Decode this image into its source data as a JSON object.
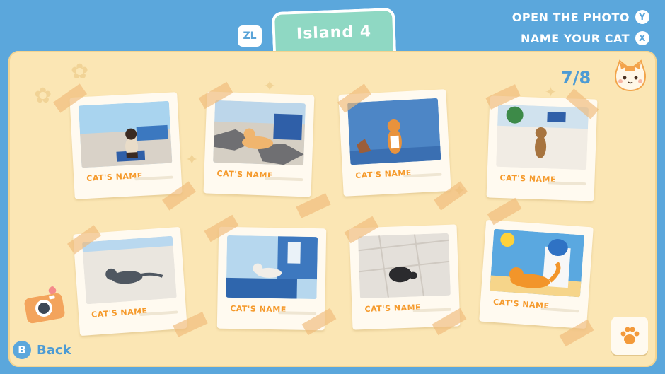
{
  "tabs": {
    "left_button": "ZL",
    "current": "Island 4"
  },
  "hints": [
    {
      "label": "OPEN THE PHOTO",
      "button": "Y"
    },
    {
      "label": "NAME YOUR CAT",
      "button": "X"
    }
  ],
  "counter": "7/8",
  "photos": [
    {
      "name": "CAT'S NAME",
      "icon": "siamese-cat-photo"
    },
    {
      "name": "CAT'S NAME",
      "icon": "orange-cat-lying-photo"
    },
    {
      "name": "CAT'S NAME",
      "icon": "orange-cat-sitting-photo"
    },
    {
      "name": "CAT'S NAME",
      "icon": "tabby-cat-photo"
    },
    {
      "name": "CAT'S NAME",
      "icon": "grey-cat-photo"
    },
    {
      "name": "CAT'S NAME",
      "icon": "white-cat-on-table-photo"
    },
    {
      "name": "CAT'S NAME",
      "icon": "black-cat-curled-photo"
    },
    {
      "name": "CAT'S NAME",
      "icon": "cartoon-orange-cat-photo"
    }
  ],
  "footer": {
    "back_button": "B",
    "back_label": "Back"
  },
  "colors": {
    "background": "#5ba7dc",
    "panel": "#fbe6b4",
    "accent": "#4d9bd4",
    "name_text": "#f59a2c",
    "tab": "#8fd8c3"
  }
}
